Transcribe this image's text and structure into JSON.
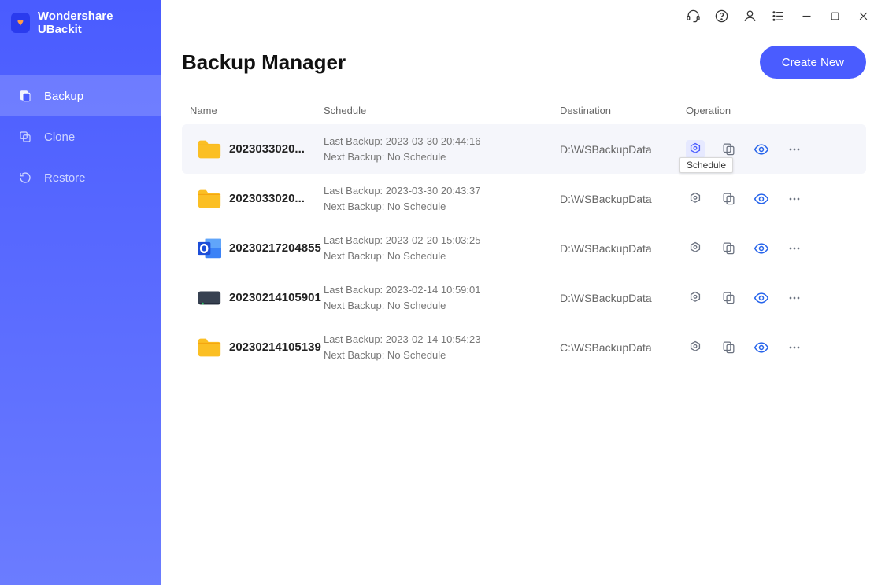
{
  "app": {
    "title": "Wondershare UBackit"
  },
  "sidebar": {
    "items": [
      {
        "label": "Backup",
        "icon": "backup-icon",
        "active": true
      },
      {
        "label": "Clone",
        "icon": "clone-icon",
        "active": false
      },
      {
        "label": "Restore",
        "icon": "restore-icon",
        "active": false
      }
    ]
  },
  "header": {
    "title": "Backup Manager",
    "create_label": "Create New"
  },
  "columns": {
    "name": "Name",
    "schedule": "Schedule",
    "destination": "Destination",
    "operation": "Operation"
  },
  "tooltip": "Schedule",
  "schedule_labels": {
    "last_prefix": "Last Backup: ",
    "next_prefix": "Next Backup: "
  },
  "rows": [
    {
      "icon": "folder",
      "name": "2023033020...",
      "last": "2023-03-30 20:44:16",
      "next": "No Schedule",
      "dest": "D:\\WSBackupData",
      "hover": true
    },
    {
      "icon": "folder",
      "name": "2023033020...",
      "last": "2023-03-30 20:43:37",
      "next": "No Schedule",
      "dest": "D:\\WSBackupData",
      "hover": false
    },
    {
      "icon": "outlook",
      "name": "20230217204855",
      "last": "2023-02-20 15:03:25",
      "next": "No Schedule",
      "dest": "D:\\WSBackupData",
      "hover": false
    },
    {
      "icon": "disk",
      "name": "20230214105901",
      "last": "2023-02-14 10:59:01",
      "next": "No Schedule",
      "dest": "D:\\WSBackupData",
      "hover": false
    },
    {
      "icon": "folder",
      "name": "20230214105139",
      "last": "2023-02-14 10:54:23",
      "next": "No Schedule",
      "dest": "C:\\WSBackupData",
      "hover": false
    }
  ],
  "titlebar_icons": [
    "headset",
    "help",
    "user",
    "list",
    "minimize",
    "maximize",
    "close"
  ]
}
